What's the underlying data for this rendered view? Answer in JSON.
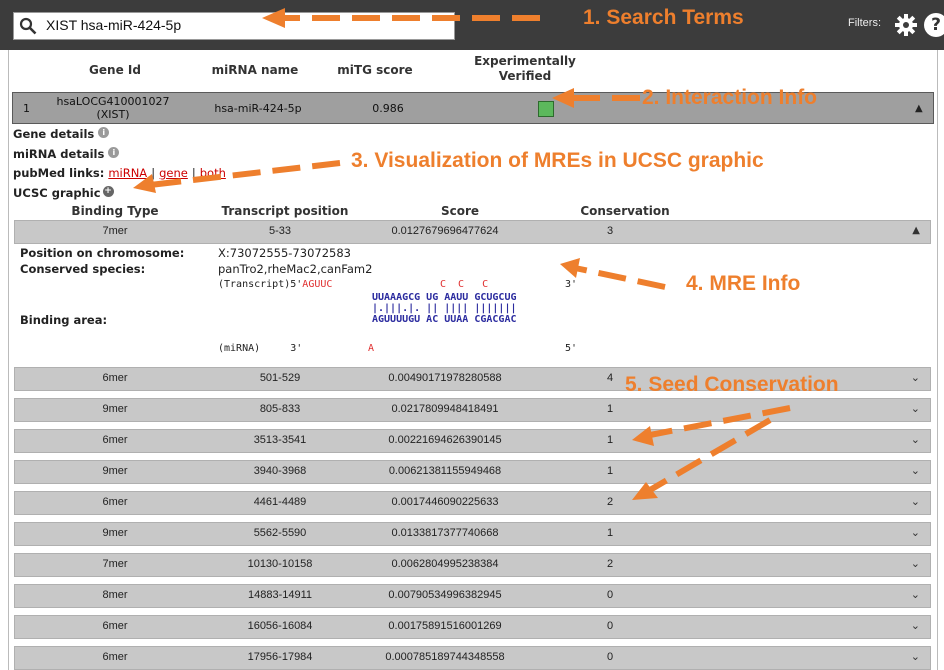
{
  "search": {
    "query": "XIST hsa-miR-424-5p",
    "filters_label": "Filters:",
    "help_label": "?"
  },
  "table_headers": {
    "gene_id": "Gene Id",
    "mirna_name": "miRNA name",
    "mitg_score": "miTG score",
    "exp_verified_1": "Experimentally",
    "exp_verified_2": "Verified"
  },
  "gene_row": {
    "index": "1",
    "gene_id_1": "hsaLOCG410001027",
    "gene_id_2": "(XIST)",
    "mirna": "hsa-miR-424-5p",
    "score": "0.986",
    "verified_color": "#5cb85c"
  },
  "details": {
    "gene_details": "Gene details",
    "mirna_details": "miRNA details",
    "pubmed_label": "pubMed links:",
    "link_mirna": "miRNA",
    "link_gene": "gene",
    "link_both": "both",
    "sep": "|",
    "ucsc": "UCSC graphic"
  },
  "binding_headers": {
    "type": "Binding Type",
    "position": "Transcript position",
    "score": "Score",
    "conservation": "Conservation"
  },
  "first_binding": {
    "type": "7mer",
    "position": "5-33",
    "score": "0.0127679696477624",
    "conservation": "3"
  },
  "mre": {
    "pos_label": "Position on chromosome:",
    "pos_value": "X:73072555-73072583",
    "species_label": "Conserved species:",
    "species_value": "panTro2,rheMac2,canFam2",
    "binding_label": "Binding area:",
    "line1_a": "(Transcript)5'",
    "line1_b": "AGUUC",
    "line1_c": "C  C   C",
    "line1_d": "3'",
    "line2": "UUAAAGCG UG AAUU GCUGCUG",
    "line3": "|.|||.|. || |||| |||||||",
    "line4": "AGUUUUGU AC UUAA CGACGAC",
    "line5_a": "(miRNA)     3'",
    "line5_b": "A",
    "line5_c": "5'"
  },
  "binding_rows": [
    {
      "type": "6mer",
      "position": "501-529",
      "score": "0.00490171978280588",
      "conservation": "4"
    },
    {
      "type": "9mer",
      "position": "805-833",
      "score": "0.0217809948418491",
      "conservation": "1"
    },
    {
      "type": "6mer",
      "position": "3513-3541",
      "score": "0.00221694626390145",
      "conservation": "1"
    },
    {
      "type": "9mer",
      "position": "3940-3968",
      "score": "0.00621381155949468",
      "conservation": "1"
    },
    {
      "type": "6mer",
      "position": "4461-4489",
      "score": "0.0017446090225633",
      "conservation": "2"
    },
    {
      "type": "9mer",
      "position": "5562-5590",
      "score": "0.0133817377740668",
      "conservation": "1"
    },
    {
      "type": "7mer",
      "position": "10130-10158",
      "score": "0.0062804995238384",
      "conservation": "2"
    },
    {
      "type": "8mer",
      "position": "14883-14911",
      "score": "0.00790534996382945",
      "conservation": "0"
    },
    {
      "type": "6mer",
      "position": "16056-16084",
      "score": "0.00175891516001269",
      "conservation": "0"
    },
    {
      "type": "6mer",
      "position": "17956-17984",
      "score": "0.000785189744348558",
      "conservation": "0"
    }
  ],
  "annotations": {
    "a1": "1. Search Terms",
    "a2": "2. Interaction Info",
    "a3": "3. Visualization of MREs in UCSC graphic",
    "a4": "4. MRE Info",
    "a5": "5. Seed Conservation",
    "color": "#ee7f2d"
  }
}
